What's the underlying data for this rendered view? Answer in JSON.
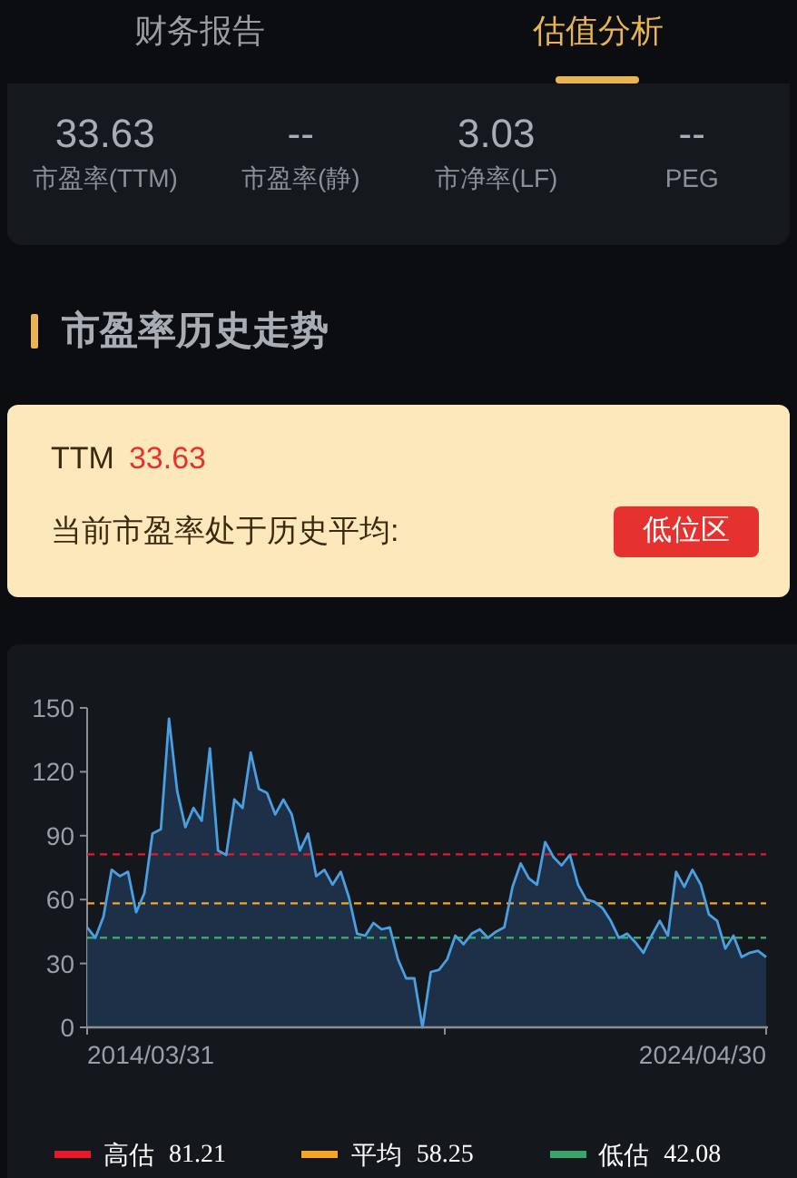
{
  "tabs": [
    {
      "label": "财务报告",
      "selected": false
    },
    {
      "label": "估值分析",
      "selected": true
    }
  ],
  "metrics": [
    {
      "value": "33.63",
      "label": "市盈率(TTM)"
    },
    {
      "value": "--",
      "label": "市盈率(静)"
    },
    {
      "value": "3.03",
      "label": "市净率(LF)"
    },
    {
      "value": "--",
      "label": "PEG"
    }
  ],
  "section_title": "市盈率历史走势",
  "valuation_card": {
    "ttm_label": "TTM",
    "ttm_value": "33.63",
    "status_text": "当前市盈率处于历史平均:",
    "status_badge": "低位区"
  },
  "pe_chart": {
    "chart_data": {
      "type": "area",
      "ylim": [
        0,
        150
      ],
      "yticks": [
        0,
        30,
        60,
        90,
        120,
        150
      ],
      "series": [
        {
          "color": "#4a9fe0",
          "values": [
            47,
            42,
            52,
            74,
            71,
            73,
            54,
            63,
            91,
            93,
            145,
            111,
            94,
            103,
            97,
            131,
            83,
            81,
            107,
            103,
            129,
            112,
            110,
            100,
            107,
            100,
            83,
            91,
            71,
            74,
            67,
            73,
            61,
            44,
            43,
            49,
            46,
            47,
            32,
            23,
            23,
            0,
            26,
            27,
            32,
            43,
            39,
            44,
            46,
            42,
            45,
            47,
            66,
            77,
            70,
            67,
            87,
            80,
            76,
            81,
            67,
            60,
            59,
            56,
            50,
            42,
            44,
            40,
            35,
            43,
            50,
            43,
            73,
            66,
            74,
            67,
            53,
            50,
            37,
            43,
            33,
            35,
            36,
            33
          ]
        },
        {
          "name": "高估",
          "type": "line",
          "line_style": "dashed",
          "color": "#e8192c",
          "values": [
            81.21,
            81.21,
            81.21,
            81.21,
            81.21,
            81.21,
            81.21,
            81.21,
            81.21,
            81.21,
            81.21,
            81.21,
            81.21,
            81.21,
            81.21,
            81.21,
            81.21,
            81.21,
            81.21,
            81.21,
            81.21,
            81.21,
            81.21,
            81.21,
            81.21,
            81.21,
            81.21,
            81.21,
            81.21,
            81.21,
            81.21,
            81.21,
            81.21,
            81.21,
            81.21,
            81.21,
            81.21,
            81.21,
            81.21,
            81.21,
            81.21,
            81.21,
            81.21,
            81.21,
            81.21,
            81.21,
            81.21,
            81.21,
            81.21,
            81.21,
            81.21,
            81.21,
            81.21,
            81.21,
            81.21,
            81.21,
            81.21,
            81.21,
            81.21,
            81.21,
            81.21,
            81.21,
            81.21,
            81.21,
            81.21,
            81.21,
            81.21,
            81.21,
            81.21,
            81.21,
            81.21,
            81.21,
            81.21,
            81.21,
            81.21,
            81.21,
            81.21,
            81.21,
            81.21,
            81.21,
            81.21,
            81.21,
            81.21,
            81.21
          ]
        },
        {
          "name": "平均",
          "type": "line",
          "line_style": "dashed",
          "color": "#f5a623",
          "values": [
            58.25,
            58.25,
            58.25,
            58.25,
            58.25,
            58.25,
            58.25,
            58.25,
            58.25,
            58.25,
            58.25,
            58.25,
            58.25,
            58.25,
            58.25,
            58.25,
            58.25,
            58.25,
            58.25,
            58.25,
            58.25,
            58.25,
            58.25,
            58.25,
            58.25,
            58.25,
            58.25,
            58.25,
            58.25,
            58.25,
            58.25,
            58.25,
            58.25,
            58.25,
            58.25,
            58.25,
            58.25,
            58.25,
            58.25,
            58.25,
            58.25,
            58.25,
            58.25,
            58.25,
            58.25,
            58.25,
            58.25,
            58.25,
            58.25,
            58.25,
            58.25,
            58.25,
            58.25,
            58.25,
            58.25,
            58.25,
            58.25,
            58.25,
            58.25,
            58.25,
            58.25,
            58.25,
            58.25,
            58.25,
            58.25,
            58.25,
            58.25,
            58.25,
            58.25,
            58.25,
            58.25,
            58.25,
            58.25,
            58.25,
            58.25,
            58.25,
            58.25,
            58.25,
            58.25,
            58.25,
            58.25,
            58.25,
            58.25,
            58.25
          ]
        },
        {
          "name": "低估",
          "type": "line",
          "line_style": "dashed",
          "color": "#3aa56a",
          "values": [
            42.08,
            42.08,
            42.08,
            42.08,
            42.08,
            42.08,
            42.08,
            42.08,
            42.08,
            42.08,
            42.08,
            42.08,
            42.08,
            42.08,
            42.08,
            42.08,
            42.08,
            42.08,
            42.08,
            42.08,
            42.08,
            42.08,
            42.08,
            42.08,
            42.08,
            42.08,
            42.08,
            42.08,
            42.08,
            42.08,
            42.08,
            42.08,
            42.08,
            42.08,
            42.08,
            42.08,
            42.08,
            42.08,
            42.08,
            42.08,
            42.08,
            42.08,
            42.08,
            42.08,
            42.08,
            42.08,
            42.08,
            42.08,
            42.08,
            42.08,
            42.08,
            42.08,
            42.08,
            42.08,
            42.08,
            42.08,
            42.08,
            42.08,
            42.08,
            42.08,
            42.08,
            42.08,
            42.08,
            42.08,
            42.08,
            42.08,
            42.08,
            42.08,
            42.08,
            42.08,
            42.08,
            42.08,
            42.08,
            42.08,
            42.08,
            42.08,
            42.08,
            42.08,
            42.08,
            42.08,
            42.08,
            42.08,
            42.08,
            42.08
          ]
        }
      ]
    },
    "x_axis_labels": [
      "2014/03/31",
      "2024/04/30"
    ]
  },
  "legend": [
    {
      "value": "81.21"
    },
    {
      "value": "58.25"
    },
    {
      "value": "42.08"
    }
  ]
}
